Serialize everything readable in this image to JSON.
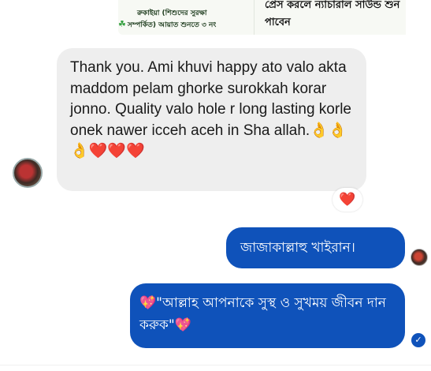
{
  "shared_image": {
    "left_line1": "রুকাইয়া (শিশুদের সুরক্ষা",
    "left_line2": "সম্পর্কিত) আয়াত শুনতে ৩ নং",
    "right_line1": "প্রেস করলে ন্যাচারাল সাউন্ড শুন",
    "right_line2": "পাবেন"
  },
  "messages": [
    {
      "direction": "incoming",
      "text": "Thank you. Ami khuvi happy ato valo akta maddom pelam ghorke surokkah korar jonno. Quality valo hole r long lasting korle onek nawer icceh aceh in Sha allah.👌👌👌❤️❤️❤️",
      "reaction": "❤️"
    },
    {
      "direction": "outgoing",
      "text": "জাজাকাল্লাহু খাইরান।"
    },
    {
      "direction": "outgoing",
      "text": "💖\"আল্লাহ আপনাকে সুস্থ ও সুখময় জীবন দান করুক\"💖"
    }
  ],
  "icons": {
    "incoming_avatar": "avatar-icon",
    "outgoing_avatar": "seen-avatar-icon",
    "delivered": "check-circle-icon",
    "reaction": "heart-icon"
  },
  "colors": {
    "outgoing_bubble": "#0f52ba",
    "incoming_bubble": "#eeeeee",
    "heart": "#e3142b"
  }
}
